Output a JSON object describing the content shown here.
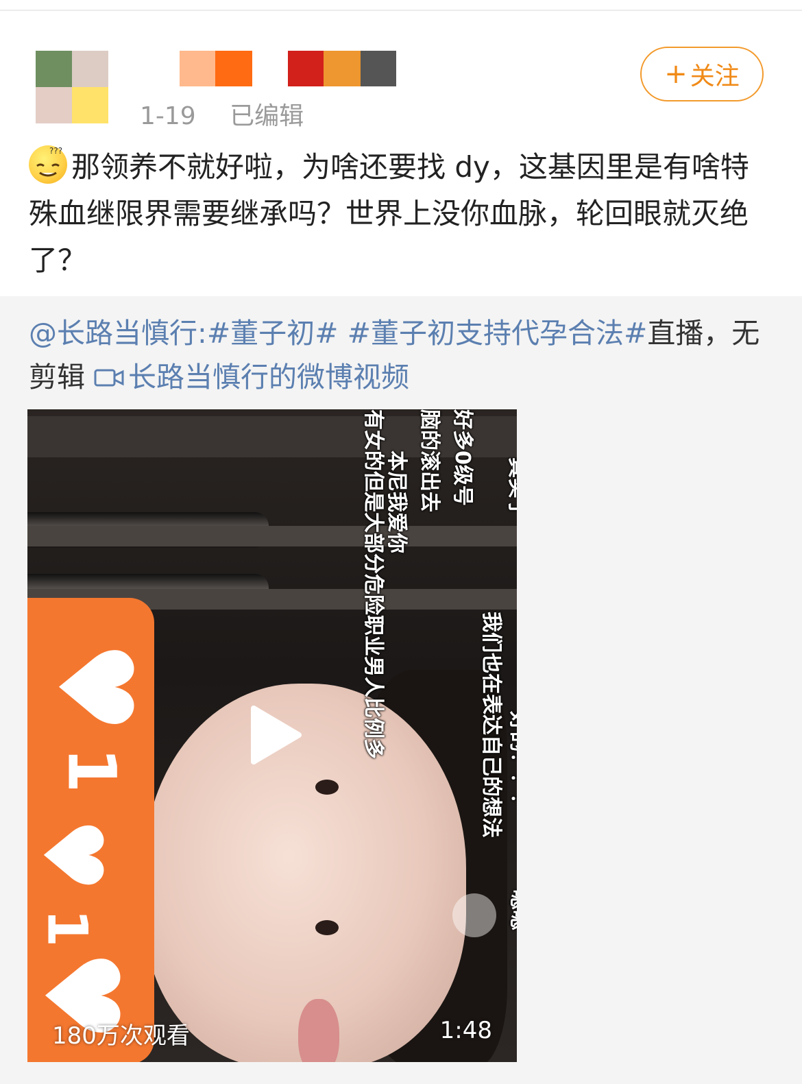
{
  "header": {
    "avatar_colors": [
      "#6f8f60",
      "#dcccc4",
      "#e3cdc5",
      "#ffe269"
    ],
    "name_mosaic_colors": [
      "#ffb98c",
      "#ff6b12",
      "#d2201a",
      "#ee962f",
      "#555555"
    ],
    "date": "1-19",
    "edited_label": "已编辑",
    "follow_plus": "+",
    "follow_label": "关注"
  },
  "post": {
    "emoji_icon": "thinking-smile-emoji",
    "text": "那领养不就好啦，为啥还要找 dy，这基因里是有啥特殊血继限界需要继承吗？世界上没你血脉，轮回眼就灭绝了？"
  },
  "repost": {
    "mention": "@长路当慎行",
    "colon": ":",
    "hashtag1": "#董子初#",
    "hashtag2": "#董子初支持代孕合法#",
    "text_after": "直播，无剪辑",
    "video_link_label": "长路当慎行的微博视频"
  },
  "video": {
    "views": "180万次观看",
    "duration": "1:48",
    "danmaku": [
      "真实了",
      "好多0级号",
      "脑的滚出去",
      "本尼我爱你",
      "有女的但是大部分危险职业男人比例多",
      "我们也在表达自己的想法",
      "好的！！！",
      "嗯嗯"
    ],
    "like_counts": [
      "1",
      "1"
    ]
  }
}
